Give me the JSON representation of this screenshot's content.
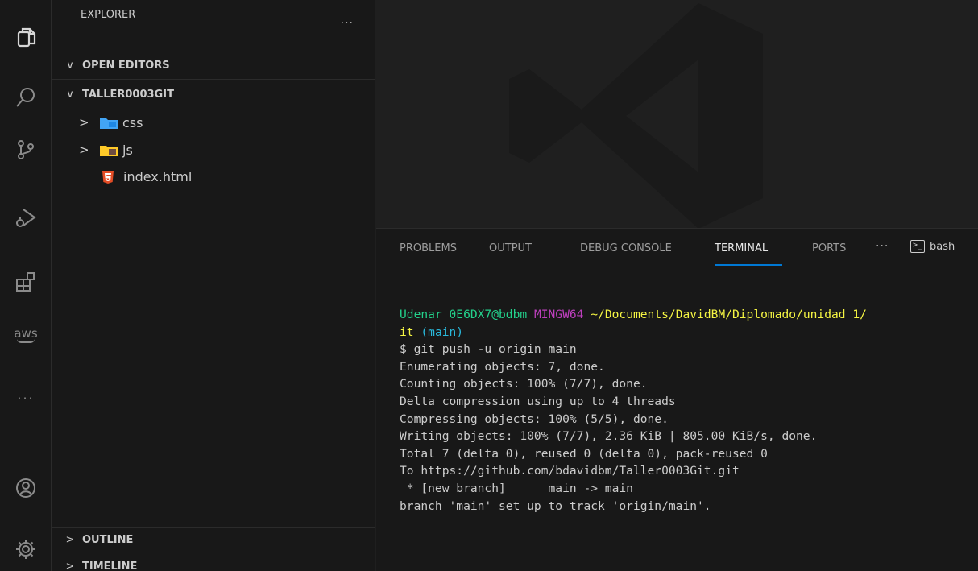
{
  "activity_bar": {
    "items": [
      {
        "name": "explorer-icon"
      },
      {
        "name": "search-icon"
      },
      {
        "name": "source-control-icon"
      },
      {
        "name": "run-debug-icon"
      },
      {
        "name": "extensions-icon"
      },
      {
        "name": "aws-icon",
        "label": "aws"
      },
      {
        "name": "more-icon",
        "label": "···"
      },
      {
        "name": "account-icon"
      },
      {
        "name": "settings-gear-icon"
      }
    ]
  },
  "sidebar": {
    "title": "EXPLORER",
    "more": "···",
    "open_editors": "OPEN EDITORS",
    "project": "TALLER0003GIT",
    "tree": [
      {
        "label": "css",
        "type": "folder",
        "icon": "css-folder-icon"
      },
      {
        "label": "js",
        "type": "folder",
        "icon": "js-folder-icon"
      },
      {
        "label": "index.html",
        "type": "file",
        "icon": "html5-file-icon"
      }
    ],
    "outline": "OUTLINE",
    "timeline": "TIMELINE",
    "chevron_open": "∨",
    "chevron_closed": ">"
  },
  "panel": {
    "tabs": {
      "problems": "PROBLEMS",
      "output": "OUTPUT",
      "debug_console": "DEBUG CONSOLE",
      "terminal": "TERMINAL",
      "ports": "PORTS"
    },
    "active_tab": "TERMINAL",
    "more": "···",
    "shell": "bash"
  },
  "terminal": {
    "prompt_user": "Udenar_0E6DX7@bdbm",
    "prompt_env": "MINGW64",
    "prompt_path": "~/Documents/DavidBM/Diplomado/unidad_1/",
    "prompt_path_cont": "it",
    "prompt_branch": "(main)",
    "lines": [
      "$ git push -u origin main",
      "Enumerating objects: 7, done.",
      "Counting objects: 100% (7/7), done.",
      "Delta compression using up to 4 threads",
      "Compressing objects: 100% (5/5), done.",
      "Writing objects: 100% (7/7), 2.36 KiB | 805.00 KiB/s, done.",
      "Total 7 (delta 0), reused 0 (delta 0), pack-reused 0",
      "To https://github.com/bdavidbm/Taller0003Git.git",
      " * [new branch]      main -> main",
      "branch 'main' set up to track 'origin/main'."
    ]
  },
  "colors": {
    "accent": "#0078d4",
    "prompt_user": "#23d18b",
    "prompt_env": "#bc3fbc",
    "prompt_path": "#f5f543",
    "prompt_branch": "#29b8db"
  }
}
